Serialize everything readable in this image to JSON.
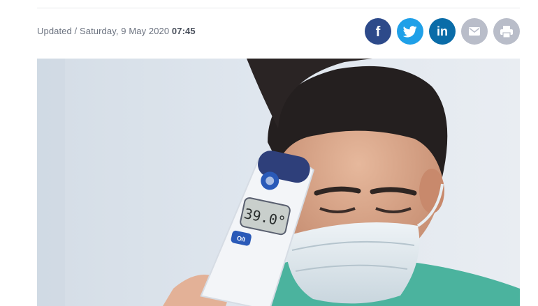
{
  "meta": {
    "updated_prefix": "Updated / Saturday, 9 May 2020 ",
    "updated_time": "07:45"
  },
  "share": {
    "facebook_glyph": "f",
    "linkedin_glyph": "in",
    "icons": [
      "facebook-icon",
      "twitter-icon",
      "linkedin-icon",
      "mail-icon",
      "print-icon"
    ]
  },
  "hero": {
    "thermometer_reading": "39.0°",
    "thermometer_button": "O/I"
  },
  "colors": {
    "facebook": "#2d4a8a",
    "twitter": "#1fa0e8",
    "linkedin": "#0a6ca8",
    "mail": "#b9bdc9",
    "print": "#b9bdc9"
  }
}
